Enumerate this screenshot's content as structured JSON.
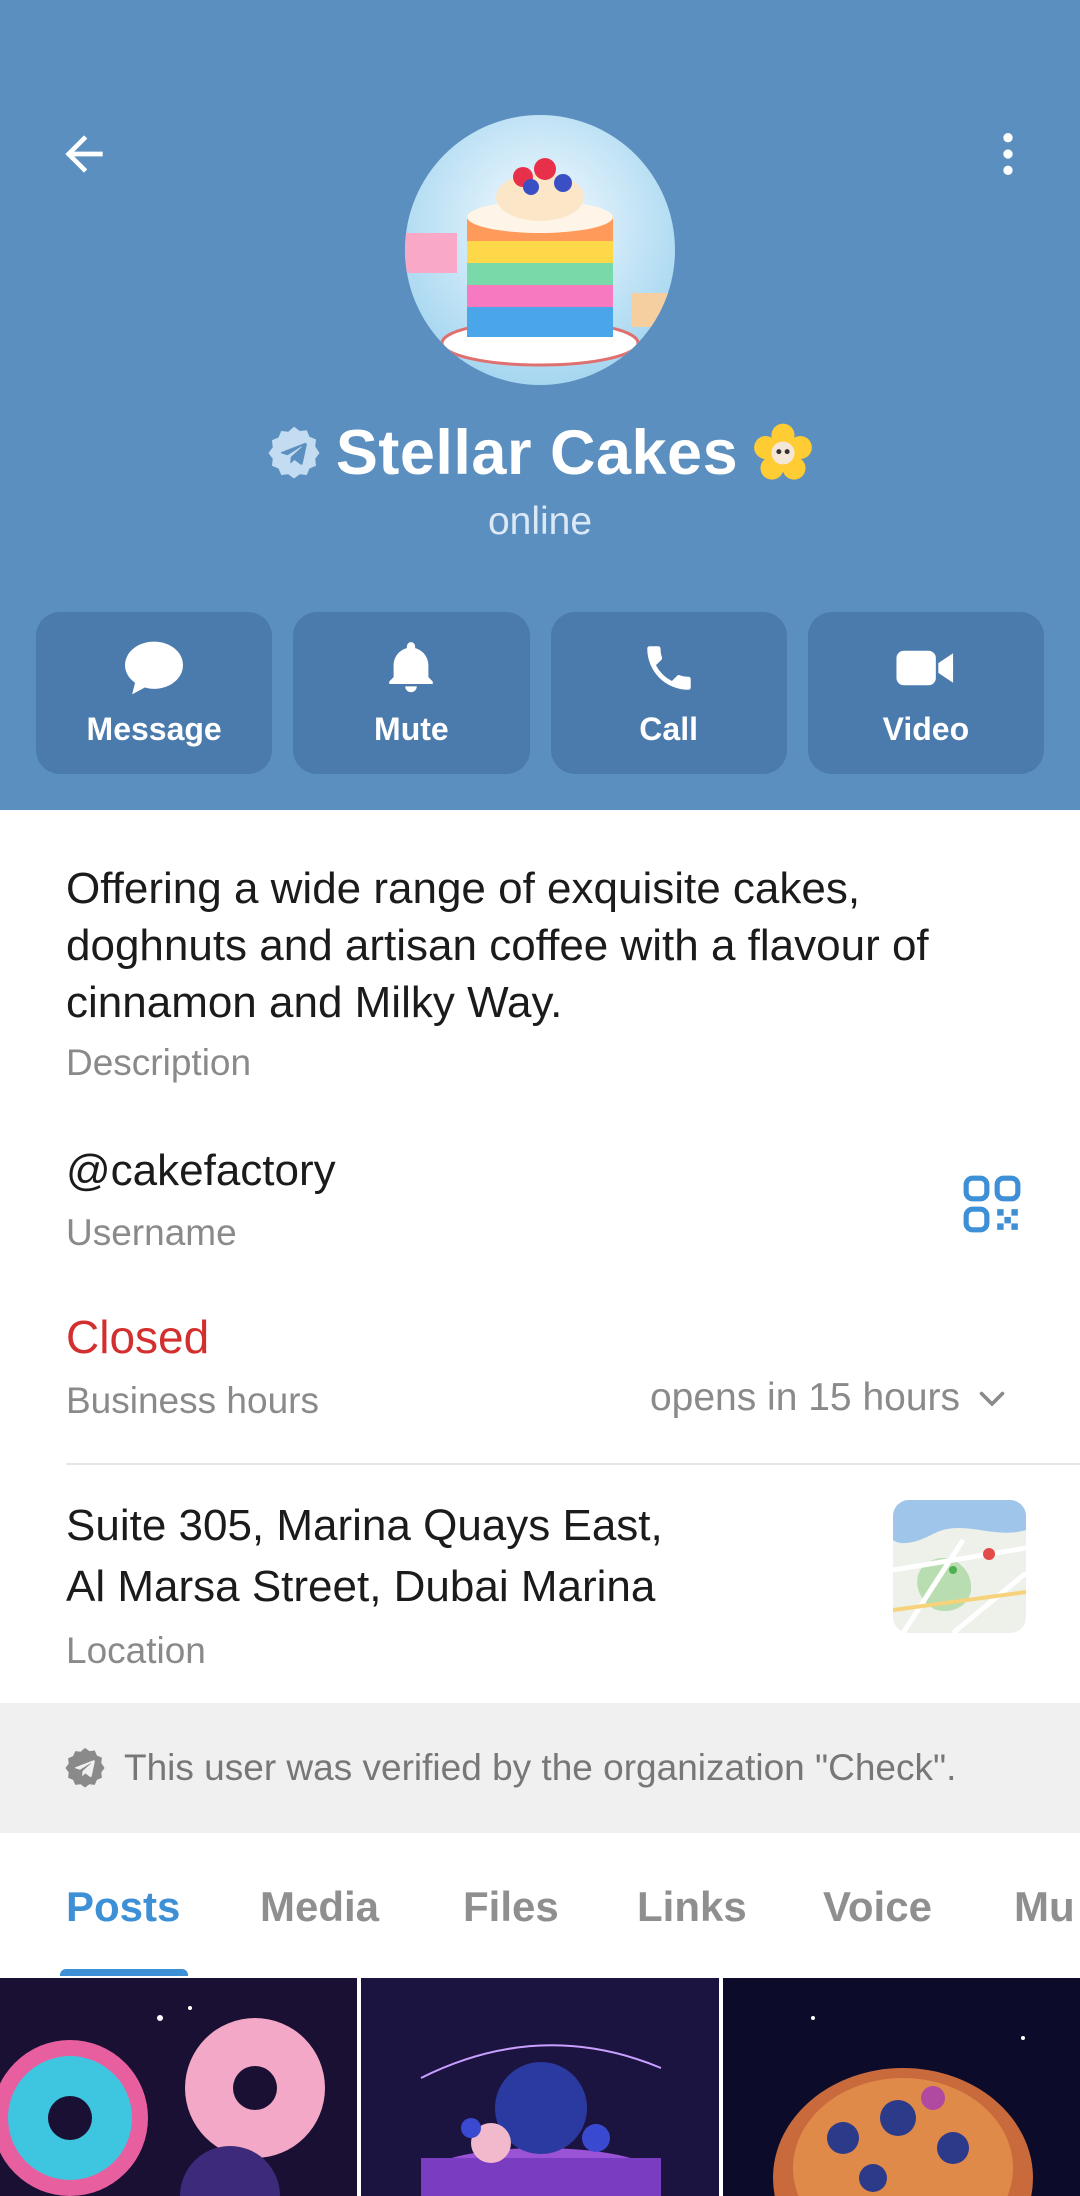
{
  "header": {
    "title": "Stellar Cakes",
    "status": "online",
    "colors": {
      "background": "#5b8fbf",
      "button": "#4a7bac"
    }
  },
  "actions": [
    {
      "label": "Message",
      "icon": "message-icon"
    },
    {
      "label": "Mute",
      "icon": "bell-icon"
    },
    {
      "label": "Call",
      "icon": "phone-icon"
    },
    {
      "label": "Video",
      "icon": "video-icon"
    }
  ],
  "info": {
    "description": "Offering a wide range of exquisite cakes, doghnuts and artisan coffee with a flavour of cinnamon and Milky Way.",
    "description_label": "Description",
    "username": "@cakefactory",
    "username_label": "Username",
    "hours_status": "Closed",
    "hours_label": "Business hours",
    "hours_next": "opens in 15 hours",
    "location_line1": "Suite 305, Marina Quays East,",
    "location_line2": "Al Marsa Street, Dubai Marina",
    "location_label": "Location"
  },
  "verified_note": "This user was verified by the organization \"Check\".",
  "tabs": [
    {
      "label": "Posts",
      "active": true
    },
    {
      "label": "Media"
    },
    {
      "label": "Files"
    },
    {
      "label": "Links"
    },
    {
      "label": "Voice"
    },
    {
      "label": "Mu"
    }
  ],
  "colors": {
    "accent": "#3d8fd6",
    "closed": "#d32f2f"
  }
}
